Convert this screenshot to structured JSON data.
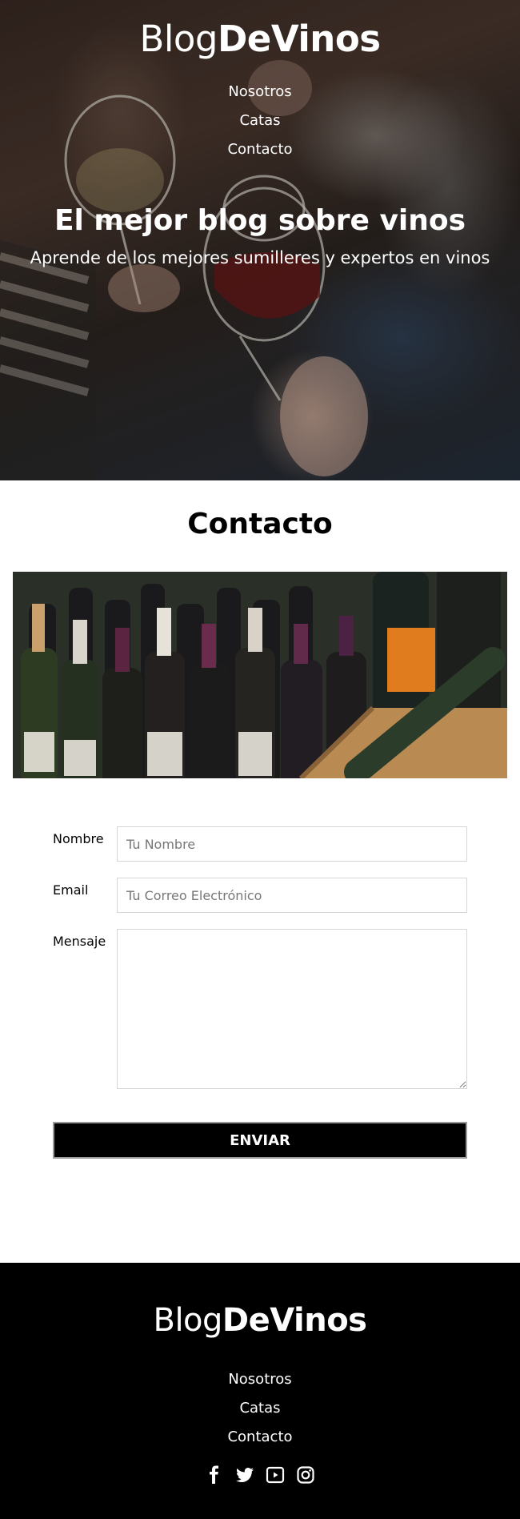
{
  "brand": {
    "light": "Blog",
    "bold": "DeVinos"
  },
  "nav": [
    {
      "label": "Nosotros"
    },
    {
      "label": "Catas"
    },
    {
      "label": "Contacto"
    }
  ],
  "hero": {
    "title": "El mejor blog sobre vinos",
    "subtitle": "Aprende de los mejores sumilleres y expertos en vinos"
  },
  "contact": {
    "title": "Contacto",
    "form": {
      "name_label": "Nombre",
      "name_placeholder": "Tu Nombre",
      "email_label": "Email",
      "email_placeholder": "Tu Correo Electrónico",
      "message_label": "Mensaje",
      "message_placeholder": "",
      "submit_label": "ENVIAR"
    }
  },
  "footer": {
    "social": [
      {
        "icon": "facebook-icon"
      },
      {
        "icon": "twitter-icon"
      },
      {
        "icon": "youtube-icon"
      },
      {
        "icon": "instagram-icon"
      }
    ]
  },
  "colors": {
    "footer_bg": "#000000",
    "button_bg": "#000000",
    "text": "#000000",
    "field_border": "#d6d6d6"
  }
}
